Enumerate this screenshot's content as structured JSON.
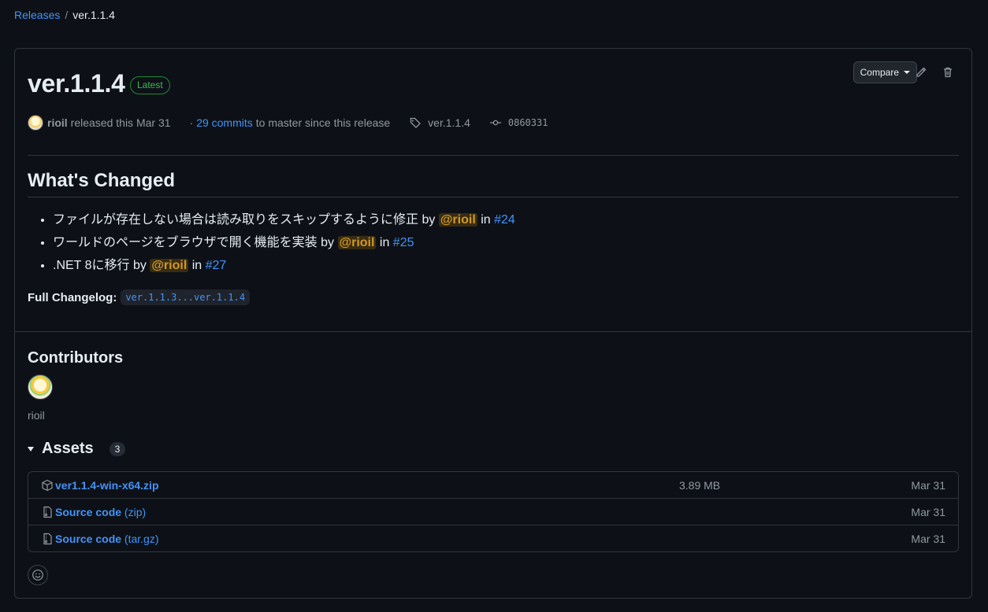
{
  "breadcrumb": {
    "root": "Releases",
    "separator": "/",
    "current": "ver.1.1.4"
  },
  "release": {
    "title": "ver.1.1.4",
    "badge": "Latest",
    "compare_label": "Compare",
    "author": "rioil",
    "released_text": "released this Mar 31",
    "commits_prefix": "·",
    "commits_link": "29 commits",
    "commits_suffix": "to master since this release",
    "tag": "ver.1.1.4",
    "commit_sha": "0860331"
  },
  "notes": {
    "heading": "What's Changed",
    "items": [
      {
        "text": "ファイルが存在しない場合は読み取りをスキップするように修正",
        "by": "by",
        "mention": "@rioil",
        "in": "in",
        "issue": "#24"
      },
      {
        "text": "ワールドのページをブラウザで開く機能を実装",
        "by": "by",
        "mention": "@rioil",
        "in": "in",
        "issue": "#25"
      },
      {
        "text": ".NET 8に移行",
        "by": "by",
        "mention": "@rioil",
        "in": "in",
        "issue": "#27"
      }
    ],
    "changelog_label": "Full Changelog:",
    "changelog_link": "ver.1.1.3...ver.1.1.4"
  },
  "contributors": {
    "heading": "Contributors",
    "names": [
      "rioil"
    ]
  },
  "assets": {
    "heading": "Assets",
    "count": "3",
    "rows": [
      {
        "name": "ver1.1.4-win-x64.zip",
        "ext": "",
        "size": "3.89 MB",
        "date": "Mar 31",
        "icon": "package-icon"
      },
      {
        "name": "Source code",
        "ext": "(zip)",
        "size": "",
        "date": "Mar 31",
        "icon": "file-zip-icon"
      },
      {
        "name": "Source code",
        "ext": "(tar.gz)",
        "size": "",
        "date": "Mar 31",
        "icon": "file-zip-icon"
      }
    ]
  },
  "colors": {
    "background": "#0d1117",
    "link": "#4493f8",
    "latest_badge": "#3fb950",
    "mention_bg": "#bb800940",
    "mention_text": "#d29922",
    "border": "#30363d"
  }
}
